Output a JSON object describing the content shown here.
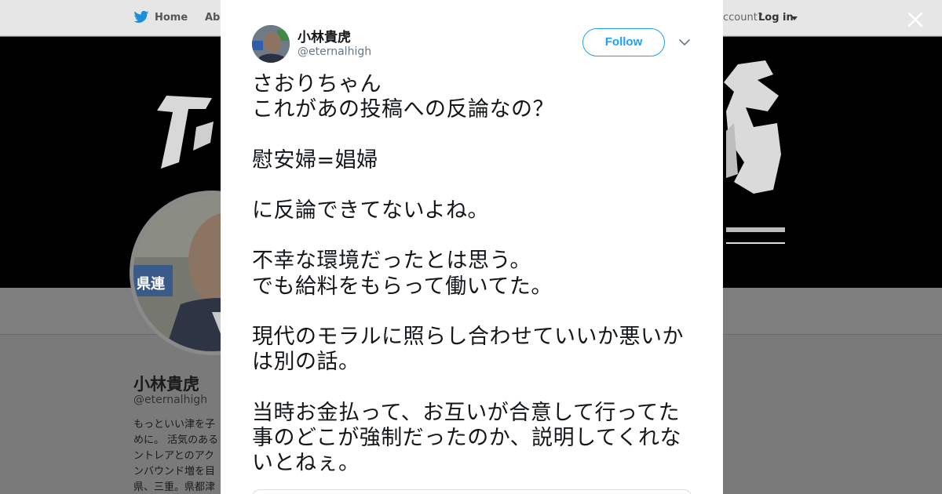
{
  "topbar": {
    "home_label": "Home",
    "about_label": "Abo",
    "account_prompt": "ccount?",
    "login_label": "Log in"
  },
  "profile": {
    "name": "小林貴虎",
    "handle": "@eternalhigh",
    "bio": "もっといい津を子めに。 活気のあるントレアとのアクンバウンド増を目県、三重。県都津"
  },
  "tweet": {
    "author_name": "小林貴虎",
    "author_handle": "@eternalhigh",
    "follow_label": "Follow",
    "text": "さおりちゃん\nこれがあの投稿への反論なの？\n\n慰安婦=娼婦\n\nに反論できてないよね。\n\n不幸な環境だったとは思う。\nでも給料をもらって働いてた。\n\n現代のモラルに照らし合わせていいか悪いかは別の話。\n\n当時お金払って、お互いが合意して行ってた事のどこが強制だったのか、説明してくれないとねぇ。"
  },
  "colors": {
    "accent": "#1da1f2",
    "text": "#14171a",
    "muted": "#657786"
  },
  "icons": {
    "logo": "twitter-bird-icon",
    "close": "close-icon",
    "menu": "chevron-down-icon"
  }
}
